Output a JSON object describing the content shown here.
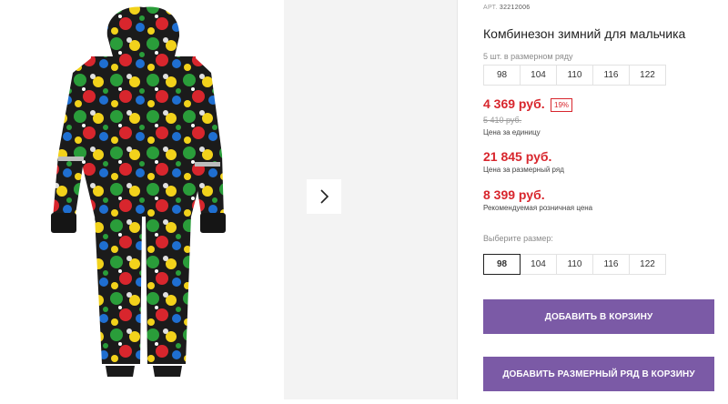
{
  "gallery": {
    "main_image": "product-photo-snowsuit",
    "next_icon": "chevron-right-icon",
    "colors": {
      "bg_next": "#f3f3f3"
    }
  },
  "product": {
    "article_label": "АРТ.",
    "article_value": "32212006",
    "title": "Комбинезон зимний для мальчика",
    "row_label": "5 шт. в размерном ряду",
    "row_sizes": [
      "98",
      "104",
      "110",
      "116",
      "122"
    ],
    "price": "4 369 руб.",
    "discount": "19%",
    "old_price": "5 410 руб.",
    "price_caption": "Цена за единицу",
    "row_price": "21 845 руб.",
    "row_price_caption": "Цена за размерный ряд",
    "retail_price": "8 399 руб.",
    "retail_caption": "Рекомендуемая розничная цена",
    "select_label": "Выберите размер:",
    "select_sizes": [
      "98",
      "104",
      "110",
      "116",
      "122"
    ],
    "selected_size": "98",
    "add_button": "ДОБАВИТЬ В КОРЗИНУ",
    "add_row_button": "ДОБАВИТЬ РАЗМЕРНЫЙ РЯД В КОРЗИНУ"
  },
  "colors": {
    "accent": "#7b5aa6",
    "price": "#d8262d"
  }
}
